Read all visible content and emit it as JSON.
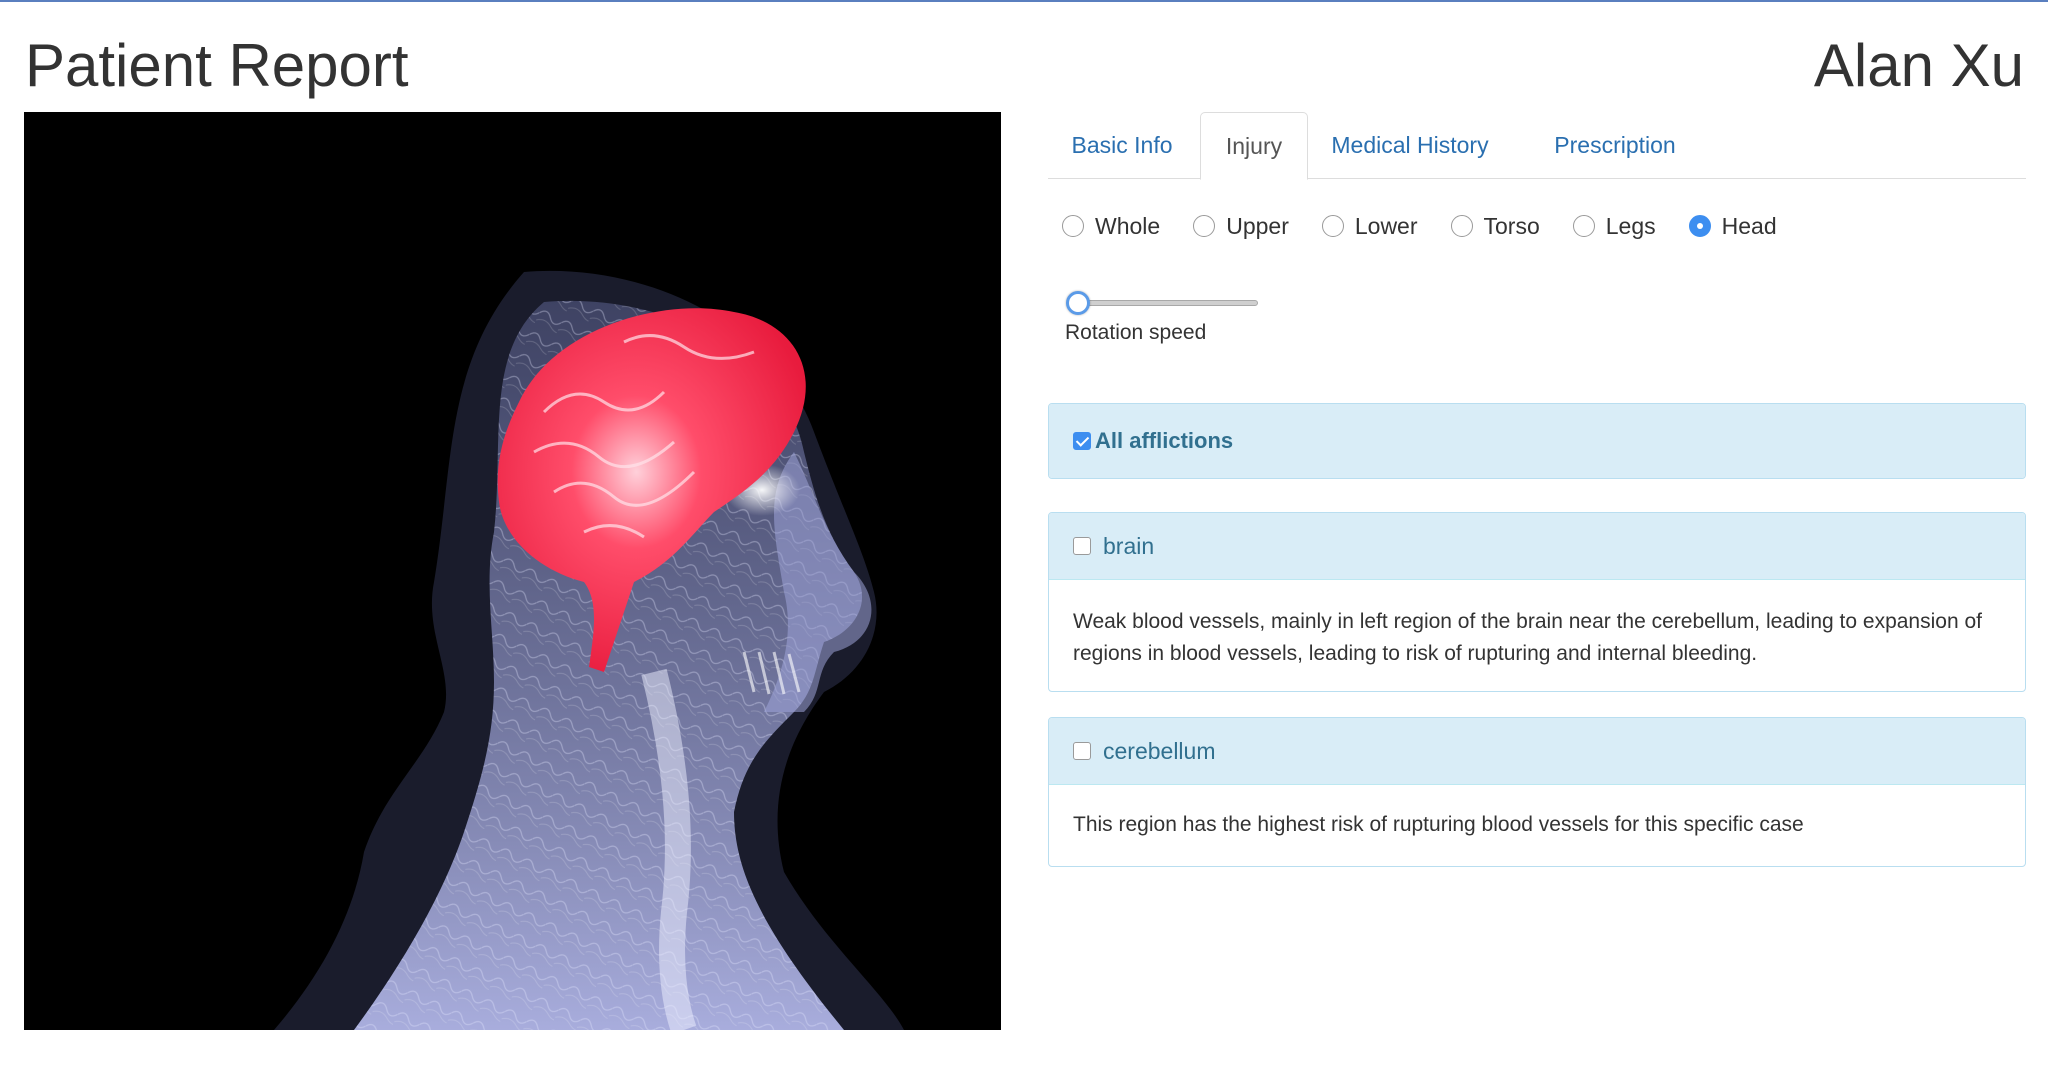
{
  "header": {
    "title": "Patient Report",
    "patient_name": "Alan Xu"
  },
  "tabs": [
    {
      "label": "Basic Info",
      "active": false
    },
    {
      "label": "Injury",
      "active": true
    },
    {
      "label": "Medical History",
      "active": false
    },
    {
      "label": "Prescription",
      "active": false
    }
  ],
  "region_options": [
    {
      "label": "Whole",
      "checked": false
    },
    {
      "label": "Upper",
      "checked": false
    },
    {
      "label": "Lower",
      "checked": false
    },
    {
      "label": "Torso",
      "checked": false
    },
    {
      "label": "Legs",
      "checked": false
    },
    {
      "label": "Head",
      "checked": true
    }
  ],
  "rotation": {
    "label": "Rotation speed",
    "value": 0
  },
  "afflictions": {
    "all_label": "All afflictions",
    "all_checked": true,
    "items": [
      {
        "name": "brain",
        "checked": false,
        "description": "Weak blood vessels, mainly in left region of the brain near the cerebellum, leading to expansion of regions in blood vessels, leading to risk of rupturing and internal bleeding."
      },
      {
        "name": "cerebellum",
        "checked": false,
        "description": "This region has the highest risk of rupturing blood vessels for this specific case"
      }
    ]
  },
  "colors": {
    "tab_link": "#2a6fb0",
    "panel_head_bg": "#d9edf7",
    "panel_head_text": "#31708f",
    "highlight_region": "#ff2b4e",
    "xray_tint": "#c8ccf0",
    "accent": "#3d8ef0"
  }
}
